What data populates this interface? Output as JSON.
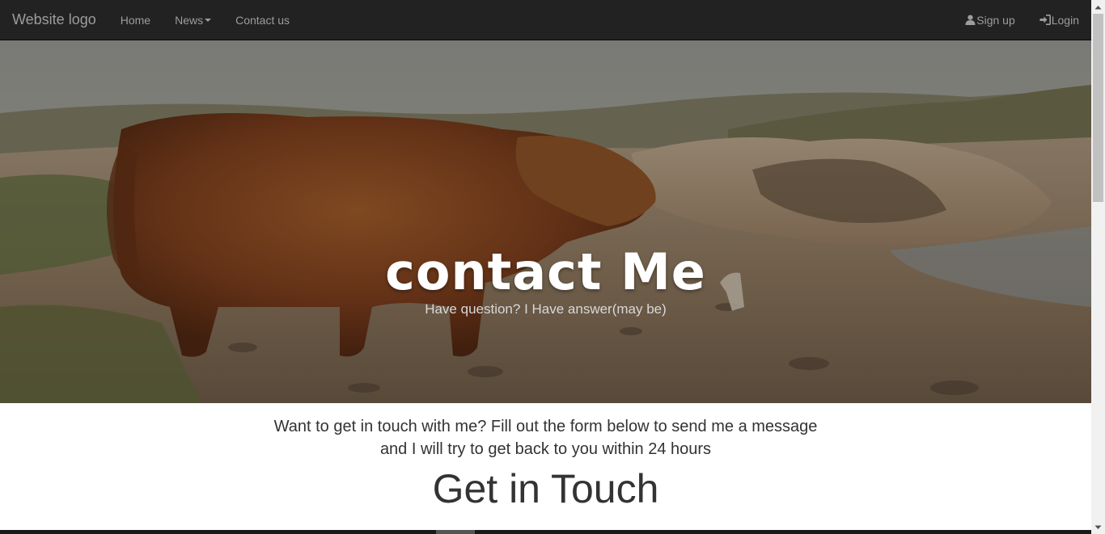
{
  "navbar": {
    "brand": "Website logo",
    "links": [
      {
        "label": "Home"
      },
      {
        "label": "News"
      },
      {
        "label": "Contact us"
      }
    ],
    "right": [
      {
        "label": "Sign up",
        "icon": "user-icon"
      },
      {
        "label": "Login",
        "icon": "login-icon"
      }
    ]
  },
  "hero": {
    "title": "contact Me",
    "subtitle": "Have question? I Have answer(may be)"
  },
  "content": {
    "intro_line1": "Want to get in touch with me? Fill out the form below to send me a message",
    "intro_line2": "and I will try to get back to you within 24 hours",
    "heading": "Get in Touch"
  },
  "colors": {
    "navbar_bg": "#222222",
    "nav_text": "#9d9d9d",
    "body_text": "#333333"
  }
}
